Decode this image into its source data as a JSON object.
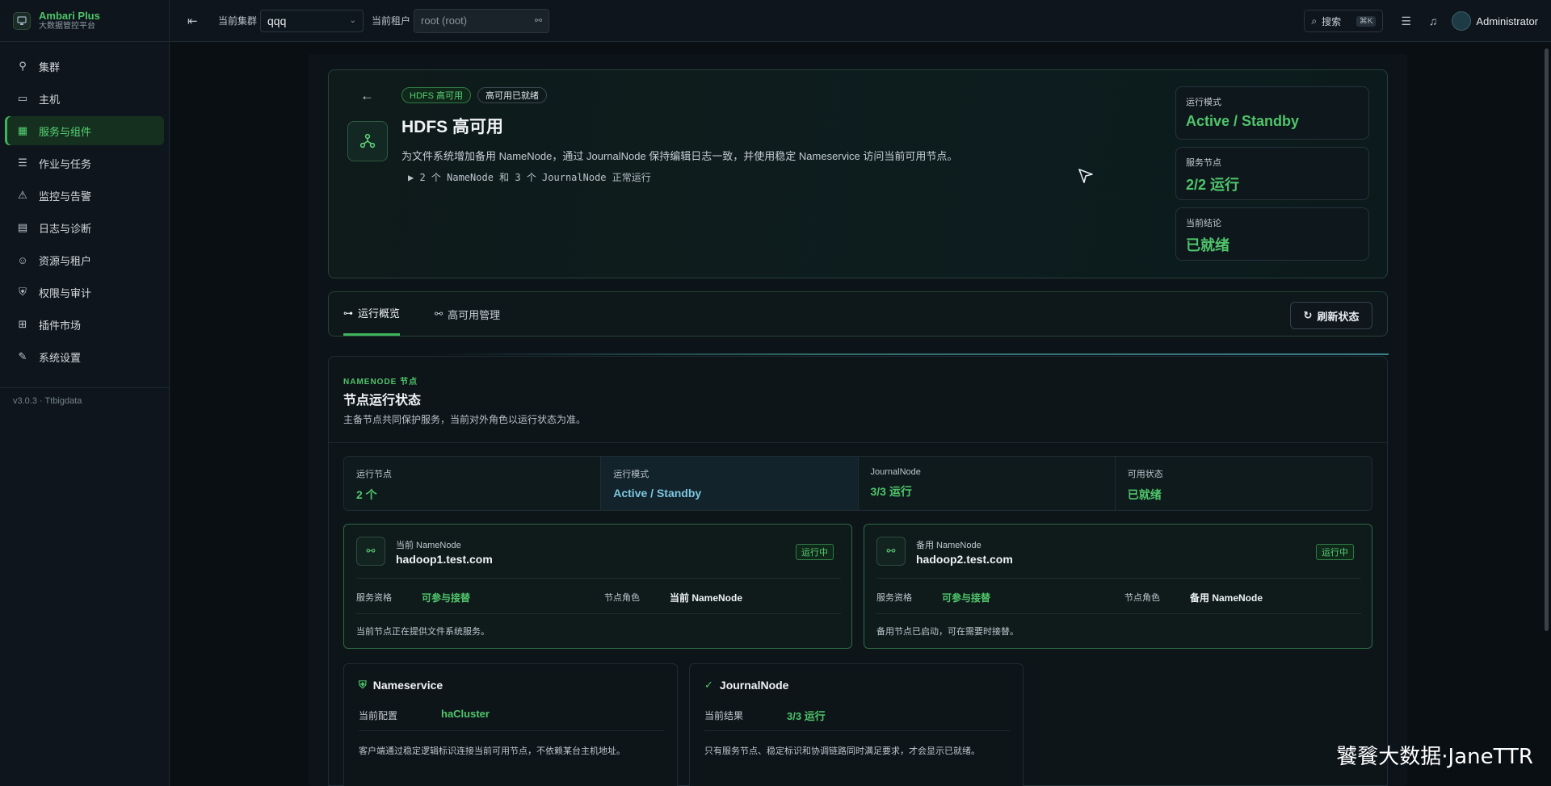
{
  "brand": {
    "name": "Ambari Plus",
    "subtitle": "大数据管控平台"
  },
  "sidebar": {
    "items": [
      {
        "label": "集群",
        "icon": "rocket-icon",
        "glyph": "⚲",
        "active": false
      },
      {
        "label": "主机",
        "icon": "monitor-icon",
        "glyph": "▭",
        "active": false
      },
      {
        "label": "服务与组件",
        "icon": "grid-icon",
        "glyph": "▦",
        "active": true
      },
      {
        "label": "作业与任务",
        "icon": "list-icon",
        "glyph": "☰",
        "active": false
      },
      {
        "label": "监控与告警",
        "icon": "siren-icon",
        "glyph": "⚠",
        "active": false
      },
      {
        "label": "日志与诊断",
        "icon": "file-search-icon",
        "glyph": "▤",
        "active": false
      },
      {
        "label": "资源与租户",
        "icon": "users-icon",
        "glyph": "☺",
        "active": false
      },
      {
        "label": "权限与审计",
        "icon": "shield-icon",
        "glyph": "⛨",
        "active": false
      },
      {
        "label": "插件市场",
        "icon": "plugin-icon",
        "glyph": "⊞",
        "active": false
      },
      {
        "label": "系统设置",
        "icon": "wrench-icon",
        "glyph": "✎",
        "active": false
      }
    ],
    "version": "v3.0.3 · Ttbigdata"
  },
  "topbar": {
    "cluster_label": "当前集群",
    "cluster_value": "qqq",
    "tenant_label": "当前租户",
    "tenant_value": "root (root)",
    "search_label": "搜索",
    "search_shortcut": "⌘K",
    "user_name": "Administrator"
  },
  "hero": {
    "tags": [
      "HDFS 高可用",
      "高可用已就绪"
    ],
    "title": "HDFS 高可用",
    "description": "为文件系统增加备用 NameNode，通过 JournalNode 保持编辑日志一致，并使用稳定 Nameservice 访问当前可用节点。",
    "detail": "▶ 2 个 NameNode 和 3 个 JournalNode 正常运行",
    "stats": [
      {
        "label": "运行模式",
        "value": "Active / Standby"
      },
      {
        "label": "服务节点",
        "value": "2/2 运行"
      },
      {
        "label": "当前结论",
        "value": "已就绪"
      }
    ]
  },
  "tabs": {
    "items": [
      {
        "label": "运行概览",
        "active": true
      },
      {
        "label": "高可用管理",
        "active": false
      }
    ],
    "refresh_label": "刷新状态"
  },
  "panel": {
    "eyebrow": "NAMENODE 节点",
    "title": "节点运行状态",
    "description": "主备节点共同保护服务，当前对外角色以运行状态为准。",
    "metrics": [
      {
        "label": "运行节点",
        "value": "2 个"
      },
      {
        "label": "运行模式",
        "value": "Active / Standby"
      },
      {
        "label": "JournalNode",
        "value": "3/3 运行"
      },
      {
        "label": "可用状态",
        "value": "已就绪"
      }
    ],
    "nodes": [
      {
        "subtitle": "当前 NameNode",
        "host": "hadoop1.test.com",
        "badge": "运行中",
        "qual_label": "服务资格",
        "qual_value": "可参与接替",
        "role_label": "节点角色",
        "role_value": "当前 NameNode",
        "note": "当前节点正在提供文件系统服务。"
      },
      {
        "subtitle": "备用 NameNode",
        "host": "hadoop2.test.com",
        "badge": "运行中",
        "qual_label": "服务资格",
        "qual_value": "可参与接替",
        "role_label": "节点角色",
        "role_value": "备用 NameNode",
        "note": "备用节点已启动，可在需要时接替。"
      }
    ],
    "info": [
      {
        "title": "Nameservice",
        "key": "当前配置",
        "value": "haCluster",
        "note": "客户端通过稳定逻辑标识连接当前可用节点，不依赖某台主机地址。"
      },
      {
        "title": "JournalNode",
        "key": "当前结果",
        "value": "3/3 运行",
        "note": "只有服务节点、稳定标识和协调链路同时满足要求，才会显示已就绪。"
      }
    ]
  },
  "watermark": "饕餮大数据·JaneTTR",
  "colors": {
    "accent": "#4fc56a",
    "background": "#0b1117",
    "info": "#7cc7e0"
  }
}
